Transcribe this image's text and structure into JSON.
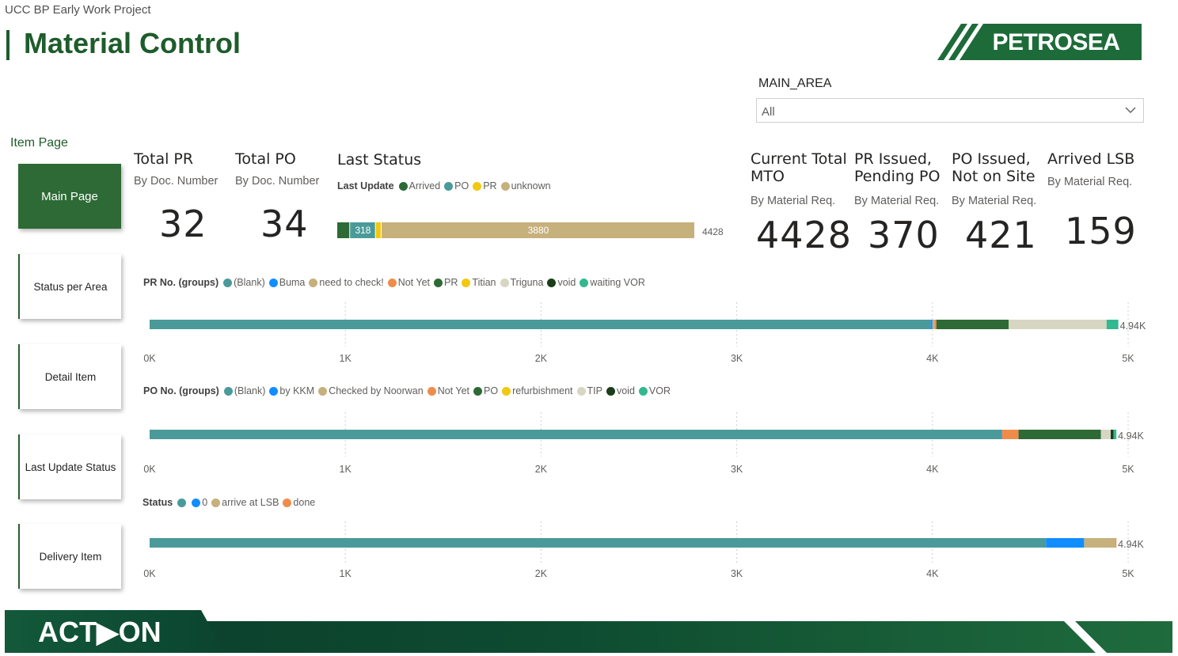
{
  "header": {
    "project": "UCC BP Early Work Project",
    "title": "Material Control",
    "logo_text": "PETROSEA"
  },
  "slicer": {
    "label": "MAIN_AREA",
    "value": "All"
  },
  "nav": {
    "section_label": "Item Page",
    "items": [
      {
        "label": "Main Page",
        "active": true
      },
      {
        "label": "Status per Area",
        "active": false
      },
      {
        "label": "Detail Item",
        "active": false
      },
      {
        "label": "Last Update Status",
        "active": false
      },
      {
        "label": "Delivery Item",
        "active": false
      }
    ]
  },
  "kpis": {
    "total_pr": {
      "title": "Total PR",
      "sub": "By Doc. Number",
      "value": "32"
    },
    "total_po": {
      "title": "Total PO",
      "sub": "By Doc. Number",
      "value": "34"
    },
    "mto": {
      "title1": "Current Total",
      "title2": "MTO",
      "sub": "By Material Req.",
      "value": "4428"
    },
    "pr_issued": {
      "title1": "PR Issued,",
      "title2": "Pending PO",
      "sub": "By Material Req.",
      "value": "370"
    },
    "po_issued": {
      "title1": "PO Issued,",
      "title2": "Not on Site",
      "sub": "By Material Req.",
      "value": "421"
    },
    "arrived": {
      "title": "Arrived LSB",
      "sub": "By Material Req.",
      "value": "159"
    }
  },
  "last_status": {
    "title": "Last Status",
    "legend_title": "Last Update",
    "legend": [
      {
        "name": "Arrived",
        "color": "#2d6a35"
      },
      {
        "name": "PO",
        "color": "#4a9a9a"
      },
      {
        "name": "PR",
        "color": "#f2c811"
      },
      {
        "name": "unknown",
        "color": "#c6b07c"
      }
    ]
  },
  "footer": {
    "brand_text": "ACT▶ON"
  },
  "chart_data": [
    {
      "type": "bar",
      "orientation": "horizontal",
      "stacked": true,
      "legend_title": "Last Update",
      "series": [
        {
          "name": "Arrived",
          "value": 159,
          "label": "",
          "color": "#2d6a35"
        },
        {
          "name": "PO",
          "value": 318,
          "label": "318",
          "color": "#4a9a9a"
        },
        {
          "name": "PR",
          "value": 71,
          "label": "",
          "color": "#f2c811"
        },
        {
          "name": "unknown",
          "value": 3880,
          "label": "3880",
          "color": "#c6b07c"
        }
      ],
      "total_label": "4428",
      "xlim": [
        0,
        4428
      ]
    },
    {
      "type": "bar",
      "orientation": "horizontal",
      "stacked": true,
      "legend_title": "PR No. (groups)",
      "series": [
        {
          "name": "(Blank)",
          "value": 3990,
          "color": "#4a9a9a"
        },
        {
          "name": "Buma",
          "value": 10,
          "color": "#118dff"
        },
        {
          "name": "need to check!",
          "value": 10,
          "color": "#c6b07c"
        },
        {
          "name": "Not Yet",
          "value": 10,
          "color": "#f08c4a"
        },
        {
          "name": "PR",
          "value": 370,
          "color": "#2d6a35"
        },
        {
          "name": "Titian",
          "value": 0,
          "color": "#f2c811"
        },
        {
          "name": "Triguna",
          "value": 500,
          "color": "#d6d6c2"
        },
        {
          "name": "void",
          "value": 0,
          "color": "#1a3d1a"
        },
        {
          "name": "waiting VOR",
          "value": 60,
          "color": "#33b88f"
        }
      ],
      "total_label": "4.94K",
      "ticks": [
        "0K",
        "1K",
        "2K",
        "3K",
        "4K",
        "5K"
      ],
      "xlim": [
        0,
        5000
      ]
    },
    {
      "type": "bar",
      "orientation": "horizontal",
      "stacked": true,
      "legend_title": "PO No. (groups)",
      "series": [
        {
          "name": "(Blank)",
          "value": 4350,
          "color": "#4a9a9a"
        },
        {
          "name": "by KKM",
          "value": 5,
          "color": "#118dff"
        },
        {
          "name": "Checked by Noorwan",
          "value": 0,
          "color": "#c6b07c"
        },
        {
          "name": "Not Yet",
          "value": 85,
          "color": "#f08c4a"
        },
        {
          "name": "PO",
          "value": 421,
          "color": "#2d6a35"
        },
        {
          "name": "refurbishment",
          "value": 0,
          "color": "#f2c811"
        },
        {
          "name": "TIP",
          "value": 50,
          "color": "#d6d6c2"
        },
        {
          "name": "void",
          "value": 14,
          "color": "#1a3d1a"
        },
        {
          "name": "VOR",
          "value": 15,
          "color": "#33b88f"
        }
      ],
      "total_label": "4.94K",
      "ticks": [
        "0K",
        "1K",
        "2K",
        "3K",
        "4K",
        "5K"
      ],
      "xlim": [
        0,
        5000
      ]
    },
    {
      "type": "bar",
      "orientation": "horizontal",
      "stacked": true,
      "legend_title": "Status",
      "series": [
        {
          "name": "",
          "value": 4580,
          "color": "#4a9a9a"
        },
        {
          "name": "0",
          "value": 195,
          "color": "#118dff"
        },
        {
          "name": "arrive at LSB",
          "value": 159,
          "color": "#c6b07c"
        },
        {
          "name": "done",
          "value": 6,
          "color": "#f08c4a"
        }
      ],
      "total_label": "4.94K",
      "ticks": [
        "0K",
        "1K",
        "2K",
        "3K",
        "4K",
        "5K"
      ],
      "xlim": [
        0,
        5000
      ]
    }
  ]
}
